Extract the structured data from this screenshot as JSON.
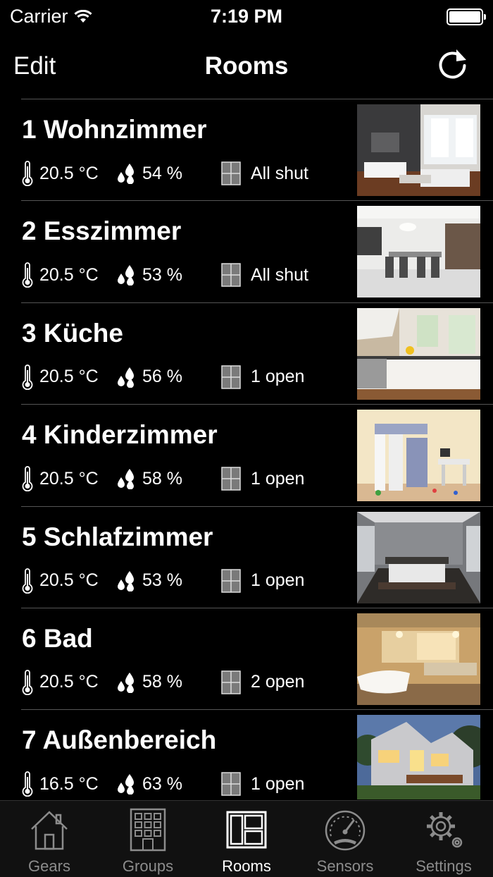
{
  "status_bar": {
    "carrier": "Carrier",
    "time": "7:19 PM"
  },
  "nav": {
    "edit_label": "Edit",
    "title": "Rooms"
  },
  "rooms": [
    {
      "name": "1 Wohnzimmer",
      "temperature": "20.5 °C",
      "humidity": "54 %",
      "windows": "All shut"
    },
    {
      "name": "2 Esszimmer",
      "temperature": "20.5 °C",
      "humidity": "53 %",
      "windows": "All shut"
    },
    {
      "name": "3 Küche",
      "temperature": "20.5 °C",
      "humidity": "56 %",
      "windows": "1 open"
    },
    {
      "name": "4 Kinderzimmer",
      "temperature": "20.5 °C",
      "humidity": "58 %",
      "windows": "1 open"
    },
    {
      "name": "5 Schlafzimmer",
      "temperature": "20.5 °C",
      "humidity": "53 %",
      "windows": "1 open"
    },
    {
      "name": "6 Bad",
      "temperature": "20.5 °C",
      "humidity": "58 %",
      "windows": "2 open"
    },
    {
      "name": "7 Außenbereich",
      "temperature": "16.5 °C",
      "humidity": "63 %",
      "windows": "1 open"
    }
  ],
  "tabs": [
    {
      "label": "Gears",
      "icon": "house-icon"
    },
    {
      "label": "Groups",
      "icon": "building-icon"
    },
    {
      "label": "Rooms",
      "icon": "floorplan-icon",
      "active": true
    },
    {
      "label": "Sensors",
      "icon": "gauge-icon"
    },
    {
      "label": "Settings",
      "icon": "gear-icon"
    }
  ]
}
